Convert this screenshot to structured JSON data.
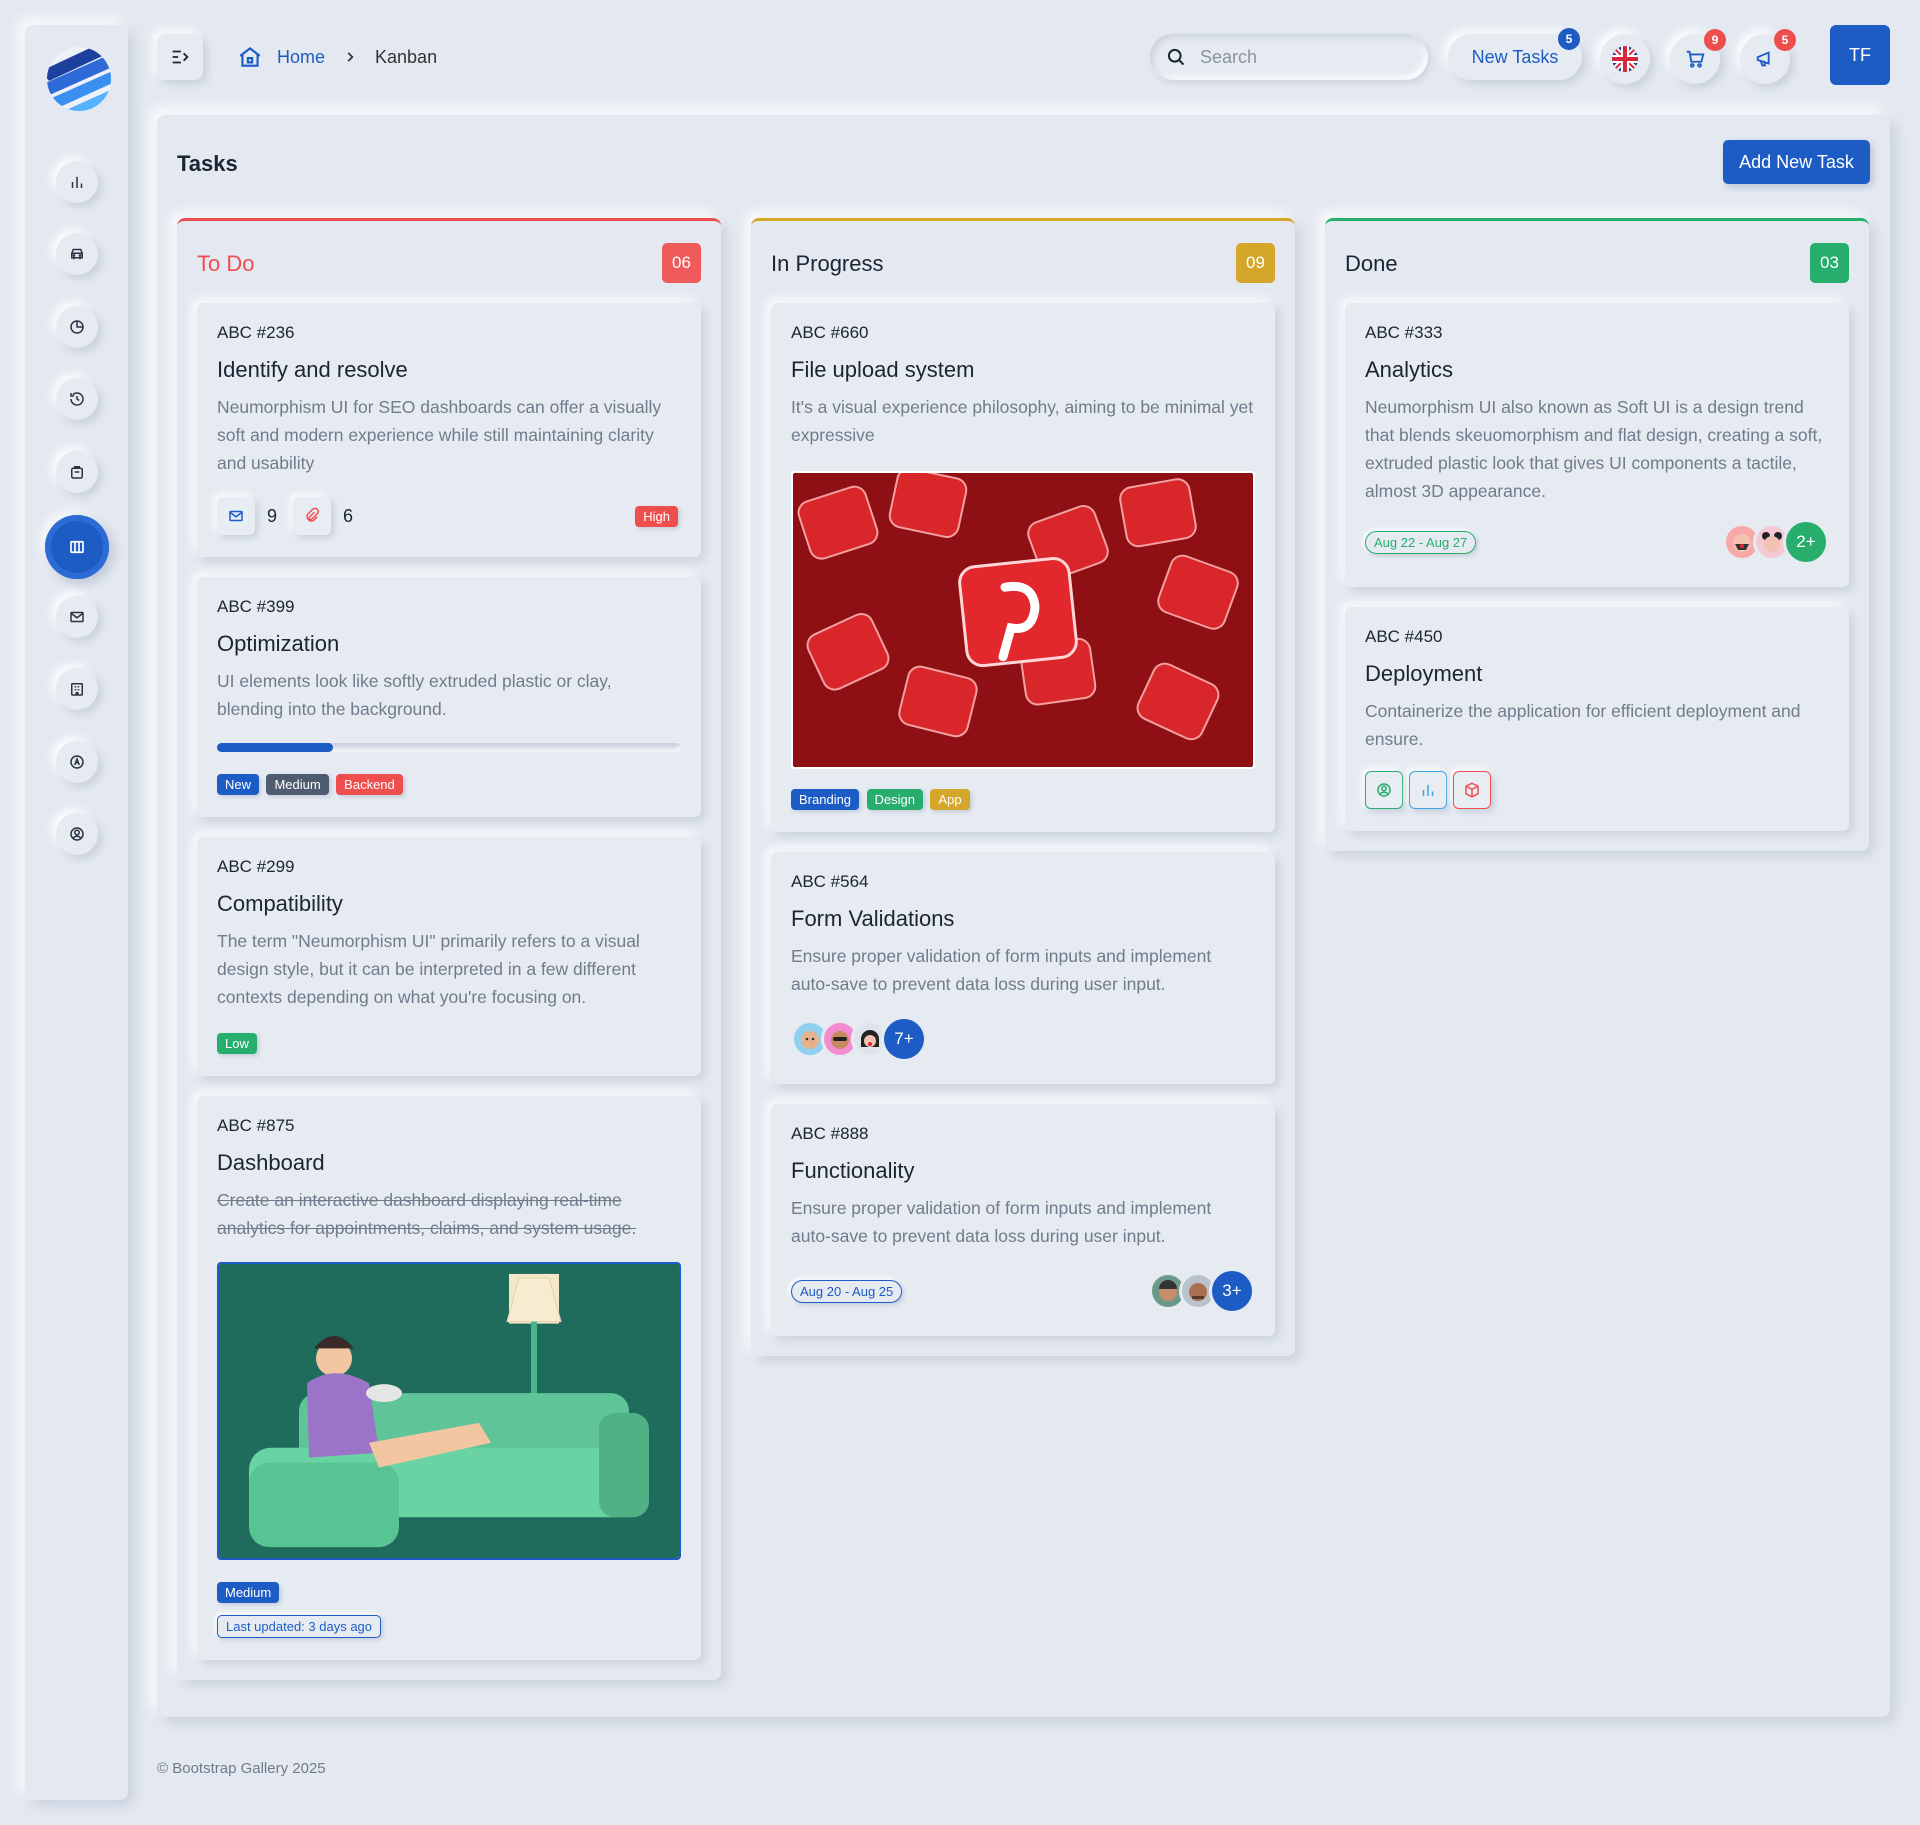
{
  "nav": {
    "items": [
      {
        "icon": "bar-chart-icon"
      },
      {
        "icon": "car-icon"
      },
      {
        "icon": "pie-chart-icon"
      },
      {
        "icon": "history-icon"
      },
      {
        "icon": "bag-icon"
      },
      {
        "icon": "kanban-icon",
        "active": true
      },
      {
        "icon": "mail-icon"
      },
      {
        "icon": "building-icon"
      },
      {
        "icon": "compass-icon"
      },
      {
        "icon": "user-circle-icon"
      }
    ]
  },
  "topbar": {
    "breadcrumb_home": "Home",
    "breadcrumb_current": "Kanban",
    "search_placeholder": "Search",
    "new_tasks_label": "New Tasks",
    "new_tasks_count": "5",
    "cart_count": "9",
    "notifications_count": "5",
    "user_initials": "TF"
  },
  "main": {
    "title": "Tasks",
    "add_button": "Add New Task"
  },
  "columns": {
    "todo": {
      "title": "To Do",
      "count": "06",
      "color": "#ef4e4e",
      "cards": [
        {
          "id": "ABC #236",
          "title": "Identify and resolve",
          "desc": "Neumorphism UI for SEO dashboards can offer a visually soft and modern experience while still maintaining clarity and usability",
          "mail_count": "9",
          "attach_count": "6",
          "priority": "High"
        },
        {
          "id": "ABC #399",
          "title": "Optimization",
          "desc": "UI elements look like softly extruded plastic or clay, blending into the background.",
          "progress": 0.25,
          "tags": [
            "New",
            "Medium",
            "Backend"
          ]
        },
        {
          "id": "ABC #299",
          "title": "Compatibility",
          "desc": "The term \"Neumorphism UI\" primarily refers to a visual design style, but it can be interpreted in a few different contexts depending on what you're focusing on.",
          "priority": "Low"
        },
        {
          "id": "ABC #875",
          "title": "Dashboard",
          "desc": "Create an interactive dashboard displaying real-time analytics for appointments, claims, and system usage.",
          "priority": "Medium",
          "updated": "Last updated: 3 days ago"
        }
      ]
    },
    "progress": {
      "title": "In Progress",
      "count": "09",
      "color": "#d4a62a",
      "cards": [
        {
          "id": "ABC #660",
          "title": "File upload system",
          "desc": "It's a visual experience philosophy, aiming to be minimal yet expressive",
          "tags": [
            "Branding",
            "Design",
            "App"
          ]
        },
        {
          "id": "ABC #564",
          "title": "Form Validations",
          "desc": "Ensure proper validation of form inputs and implement auto-save to prevent data loss during user input.",
          "more": "7+"
        },
        {
          "id": "ABC #888",
          "title": "Functionality",
          "desc": "Ensure proper validation of form inputs and implement auto-save to prevent data loss during user input.",
          "dates": "Aug 20 - Aug 25",
          "more": "3+"
        }
      ]
    },
    "done": {
      "title": "Done",
      "count": "03",
      "color": "#27ae6c",
      "cards": [
        {
          "id": "ABC #333",
          "title": "Analytics",
          "desc": "Neumorphism UI also known as Soft UI is a design trend that blends skeuomorphism and flat design, creating a soft, extruded plastic look that gives UI components a tactile, almost 3D appearance.",
          "dates": "Aug 22 - Aug 27",
          "more": "2+"
        },
        {
          "id": "ABC #450",
          "title": "Deployment",
          "desc": "Containerize the application for efficient deployment and ensure."
        }
      ]
    }
  },
  "footer": "© Bootstrap Gallery 2025"
}
